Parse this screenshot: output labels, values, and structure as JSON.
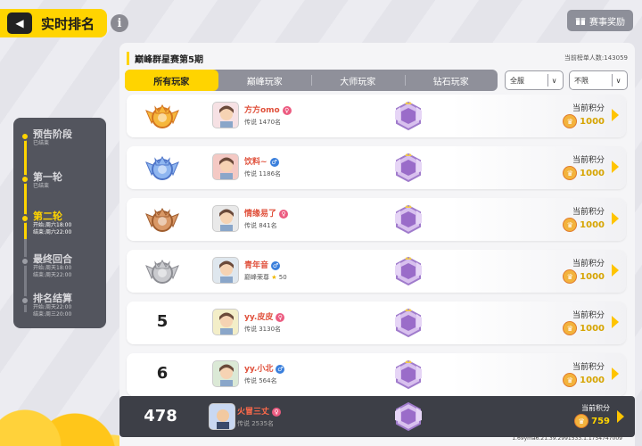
{
  "header": {
    "back_icon": "back-arrow-icon",
    "title": "实时排名",
    "info_icon": "info-icon",
    "reward_button": "赛事奖励",
    "reward_icon": "gift-icon"
  },
  "stages": [
    {
      "name": "预告阶段",
      "sub1": "已结束",
      "sub2": "",
      "state": "done"
    },
    {
      "name": "第一轮",
      "sub1": "已结束",
      "sub2": "",
      "state": "done"
    },
    {
      "name": "第二轮",
      "sub1": "开始:周六18:00",
      "sub2": "结束:周六22:00",
      "state": "active"
    },
    {
      "name": "最终回合",
      "sub1": "开始:周天18:00",
      "sub2": "结束:周天22:00",
      "state": "pending"
    },
    {
      "name": "排名结算",
      "sub1": "开始:周天22:00",
      "sub2": "结束:周三20:00",
      "state": "pending"
    }
  ],
  "panel": {
    "season_title": "巅峰群星赛第5期",
    "participant_count": "当前榜单人数:143059",
    "tabs": [
      "所有玩家",
      "巅峰玩家",
      "大师玩家",
      "钻石玩家"
    ],
    "active_tab": 0,
    "filter_server": "全服",
    "filter_limit": "不限"
  },
  "score_label": "当前积分",
  "rows": [
    {
      "rank": "1",
      "badge": "gold-crown",
      "name": "方方omo",
      "gender": "f",
      "meta": "传说 1470名",
      "score": "1000"
    },
    {
      "rank": "2",
      "badge": "silver-crown",
      "name": "饮料~",
      "gender": "m",
      "meta": "传说 1186名",
      "score": "1000"
    },
    {
      "rank": "3",
      "badge": "bronze-crown",
      "name": "情缘易了",
      "gender": "f",
      "meta": "传说 841名",
      "score": "1000"
    },
    {
      "rank": "4",
      "badge": "grey-crown",
      "name": "青年音",
      "gender": "m",
      "meta": "巅峰荣尊",
      "stars": "50",
      "score": "1000"
    },
    {
      "rank": "5",
      "badge": "",
      "name": "yy.皮皮",
      "gender": "f",
      "meta": "传说 3130名",
      "score": "1000"
    },
    {
      "rank": "6",
      "badge": "",
      "name": "yy.小北",
      "gender": "m",
      "meta": "传说 564名",
      "score": "1000"
    }
  ],
  "self_row": {
    "rank": "478",
    "name": "火冒三丈",
    "gender": "f",
    "meta": "传说 2535名",
    "score": "759"
  },
  "footer": "1.69yma6.21.39.2991533.1.1754747009",
  "colors": {
    "accent": "#ffd400",
    "panel": "#f5f5f7",
    "dark": "#3d3f47"
  }
}
